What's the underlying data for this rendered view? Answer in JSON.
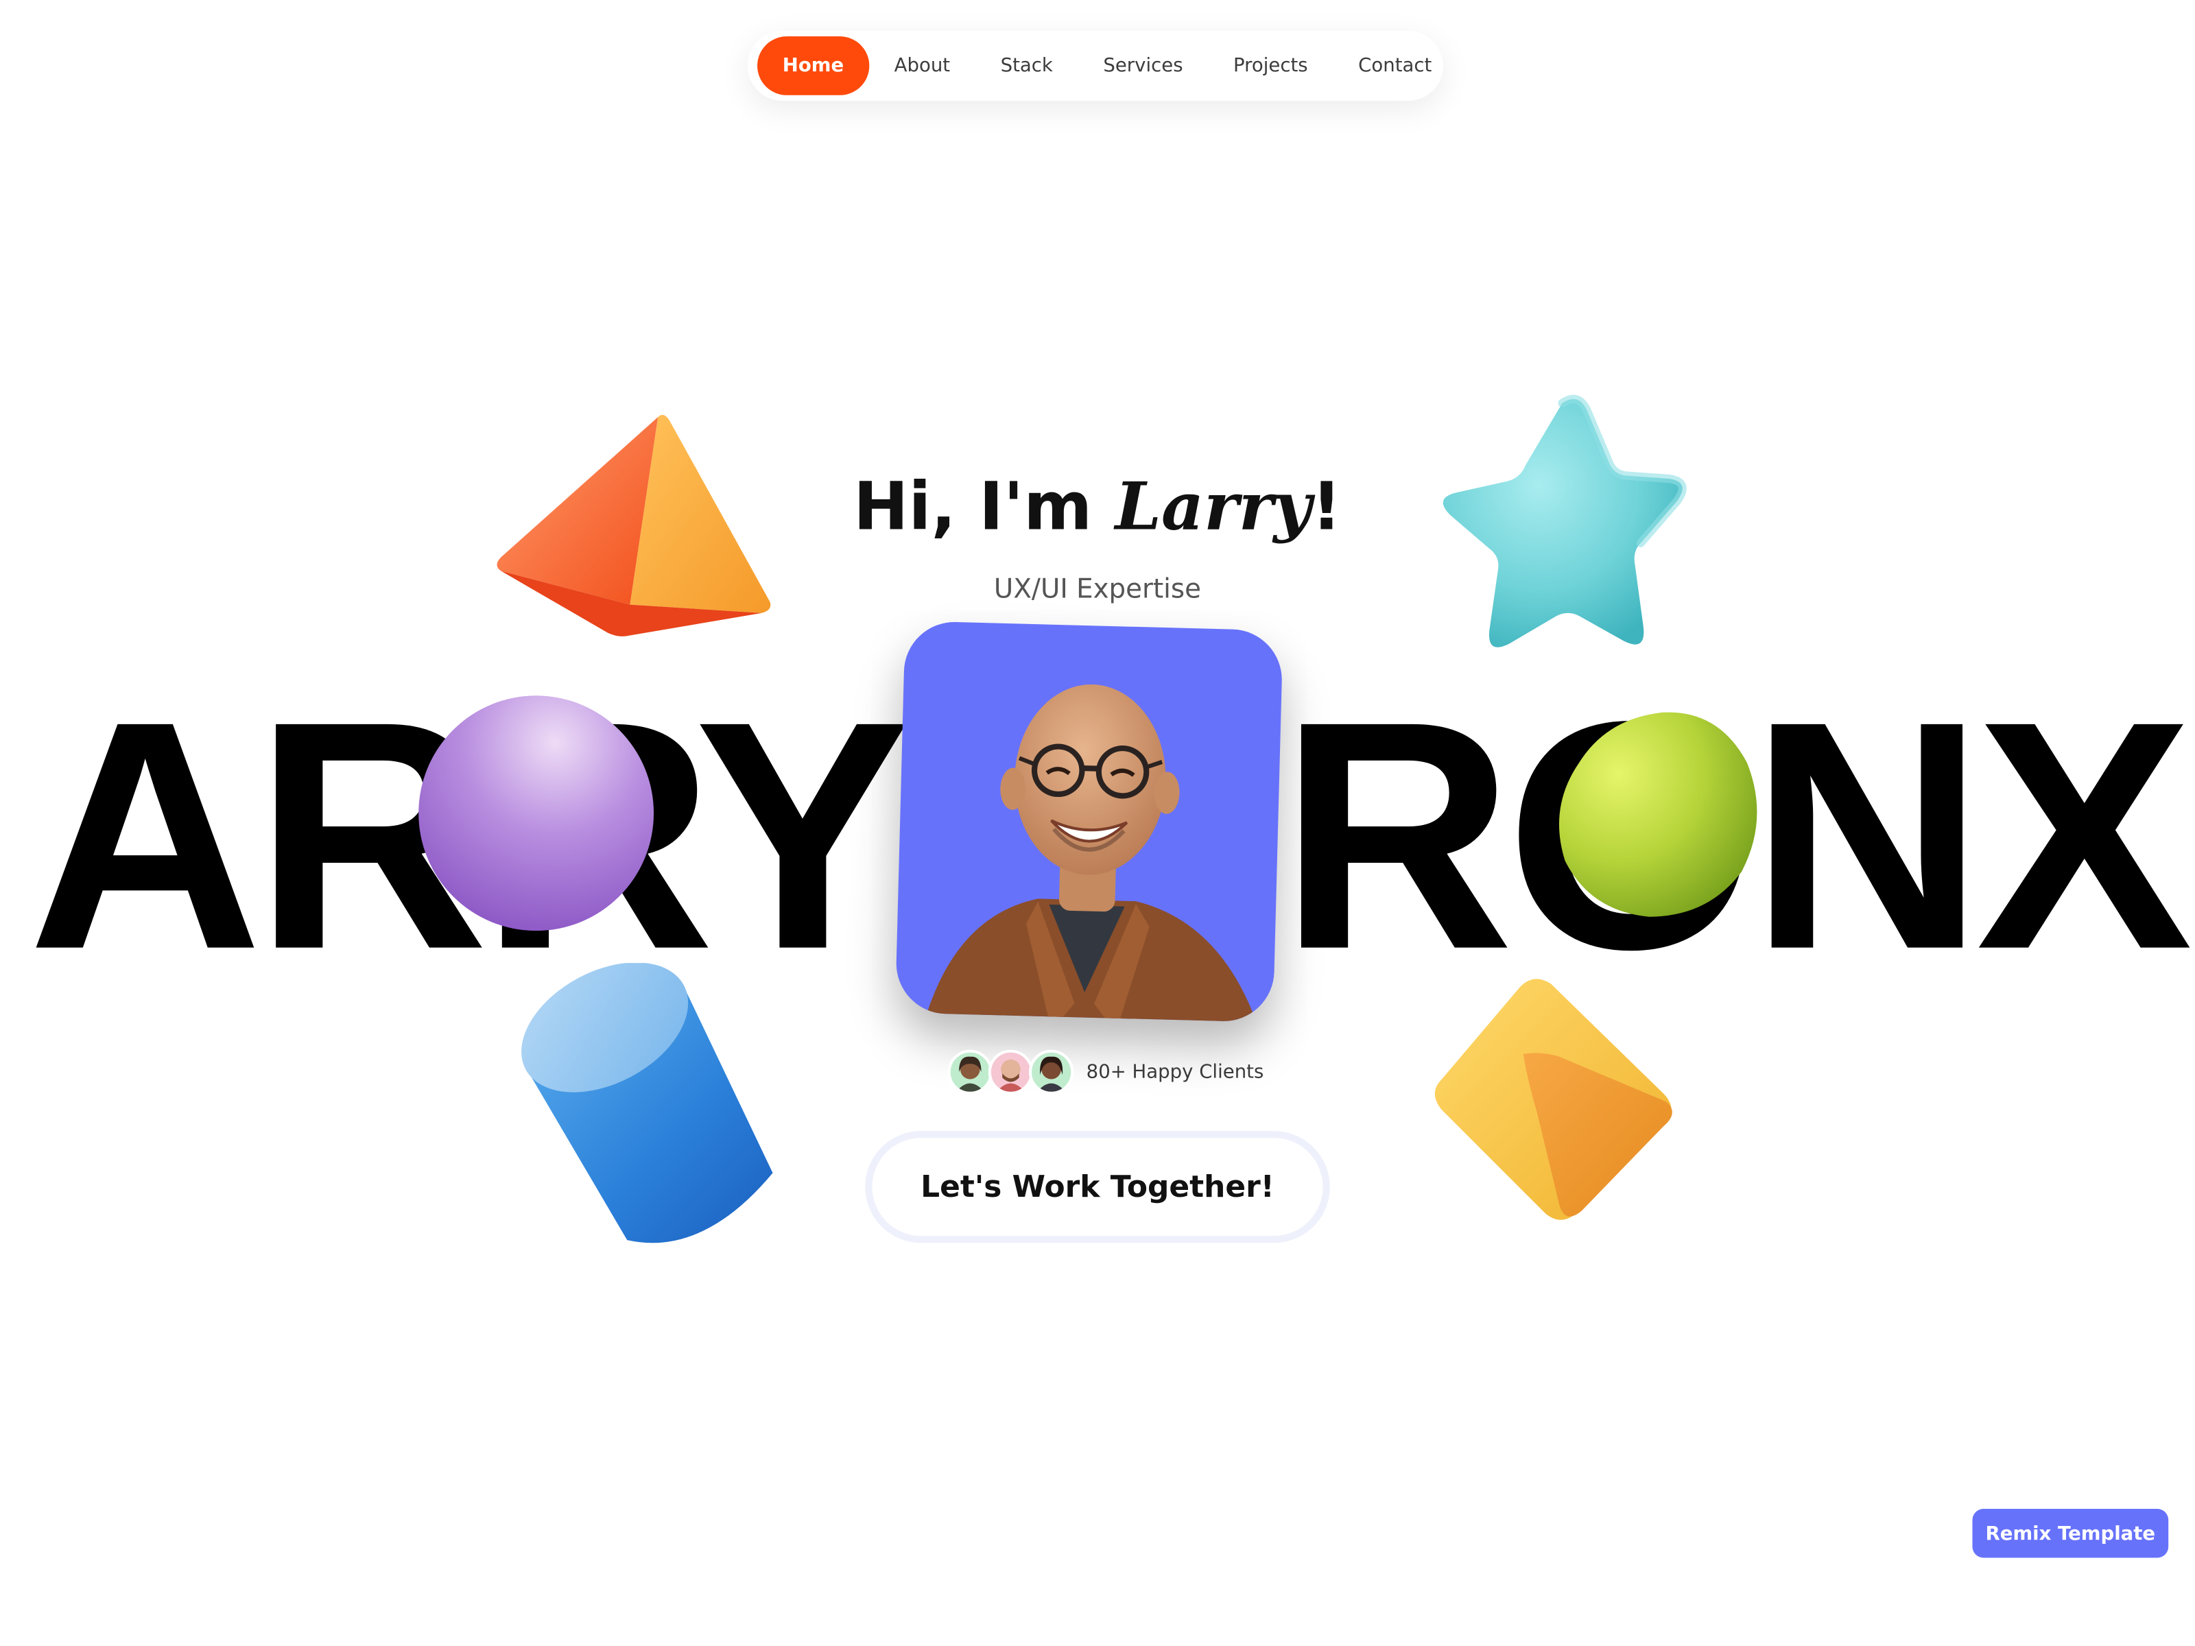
{
  "nav": {
    "items": [
      {
        "label": "Home",
        "active": true
      },
      {
        "label": "About"
      },
      {
        "label": "Stack"
      },
      {
        "label": "Services"
      },
      {
        "label": "Projects"
      },
      {
        "label": "Contact"
      }
    ]
  },
  "hero": {
    "greeting_prefix": "Hi, I'm ",
    "greeting_name": "Larry",
    "greeting_suffix": "!",
    "role": "UX/UI Expertise",
    "big_left": "ARRY",
    "big_right": "RONX",
    "clients_label": "80+ Happy Clients",
    "cta_label": "Let's Work Together!"
  },
  "footer": {
    "remix_label": "Remix Template"
  },
  "colors": {
    "accent": "#ff4a0b",
    "brand": "#6772fb"
  },
  "icons": {
    "shapes": [
      "pyramid-3d-icon",
      "star-3d-icon",
      "sphere-3d-icon",
      "rounded-cube-green-icon",
      "cylinder-3d-icon",
      "cube-3d-icon"
    ]
  }
}
